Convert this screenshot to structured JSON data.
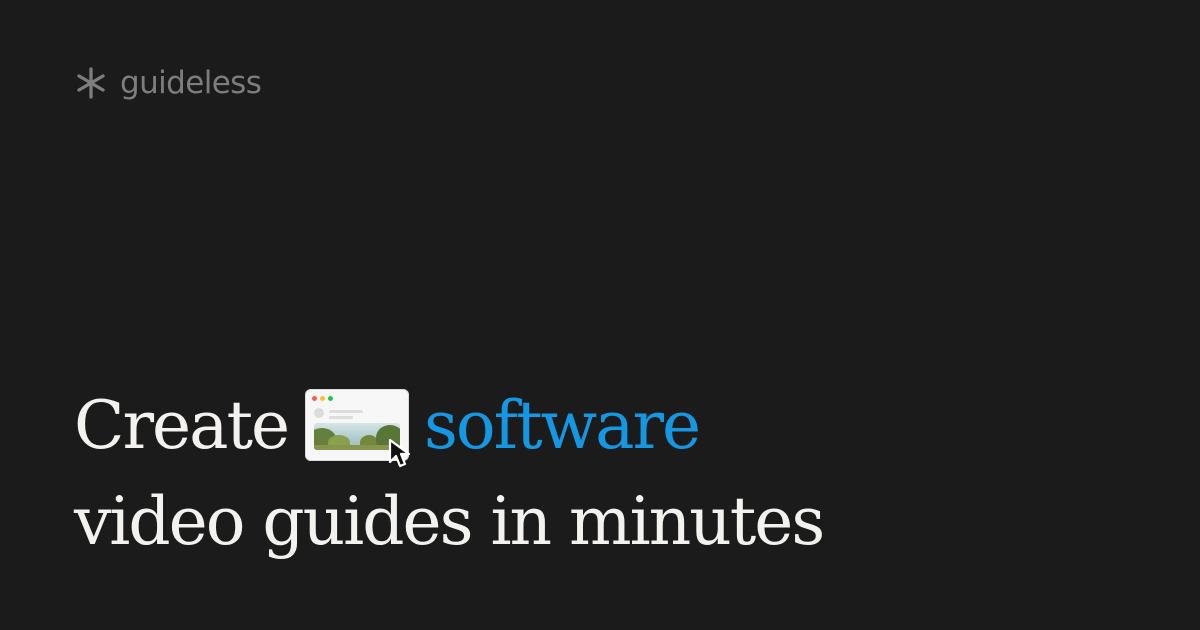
{
  "brand": {
    "name": "guideless",
    "icon": "asterisk-icon",
    "color": "#7d7d7d"
  },
  "headline": {
    "word_1": "Create",
    "accent_word": "software",
    "line_2": "video guides in minutes",
    "accent_color": "#1498e4",
    "text_color": "#f3f2ee"
  },
  "illustration": {
    "window_icon": "browser-window-icon",
    "cursor_icon": "mouse-pointer-icon"
  },
  "theme": {
    "background": "#1b1b1b"
  }
}
